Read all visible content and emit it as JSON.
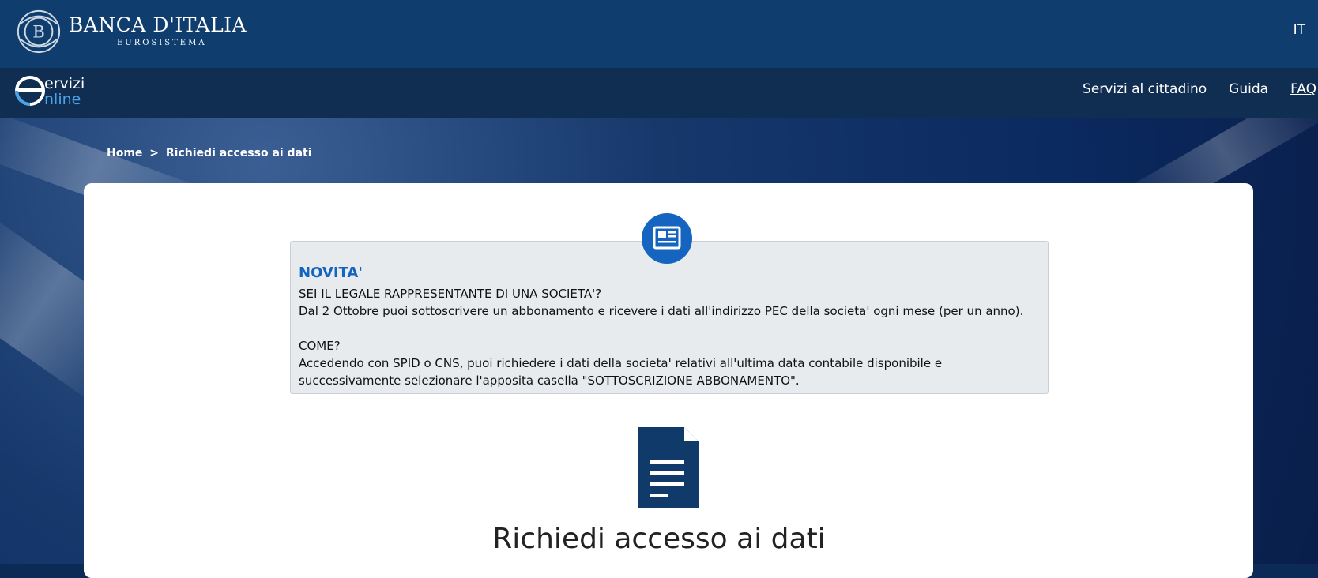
{
  "header": {
    "brand_name": "BANCA D'ITALIA",
    "brand_sub": "EUROSISTEMA",
    "lang": "IT"
  },
  "service": {
    "logo_line1": "ervizi",
    "logo_line2": "nline",
    "nav": [
      "Servizi al cittadino",
      "Guida",
      "FAQ"
    ]
  },
  "breadcrumb": {
    "home": "Home",
    "separator": ">",
    "current": "Richiedi accesso ai dati"
  },
  "news": {
    "title": "NOVITA'",
    "line1": "SEI IL LEGALE RAPPRESENTANTE DI UNA SOCIETA'?",
    "line2": "Dal 2 Ottobre puoi sottoscrivere un abbonamento e ricevere i dati all'indirizzo PEC della societa' ogni mese (per un anno).",
    "line3": "COME?",
    "line4": "Accedendo con SPID o CNS, puoi richiedere i dati della societa' relativi all'ultima data contabile disponibile e",
    "line5": "successivamente selezionare l'apposita casella \"SOTTOSCRIZIONE ABBONAMENTO\"."
  },
  "main": {
    "title": "Richiedi accesso ai dati"
  },
  "icons": {
    "brand": "bank-of-italy-logo-icon",
    "service": "servizi-online-logo-icon",
    "news": "newspaper-icon",
    "document": "document-icon"
  }
}
